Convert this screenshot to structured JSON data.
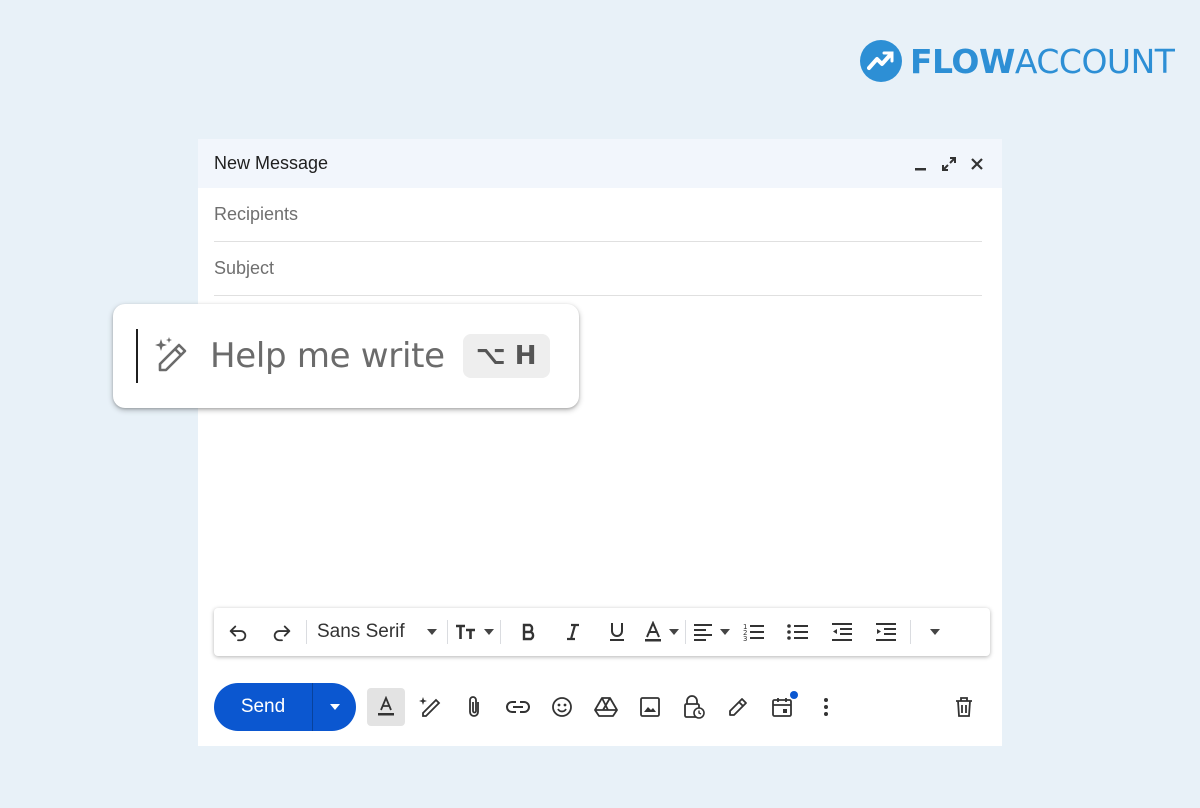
{
  "brand": {
    "logo_bold": "FLOW",
    "logo_light": "ACCOUNT",
    "color": "#2d8fd5"
  },
  "compose": {
    "title": "New Message",
    "recipients_placeholder": "Recipients",
    "subject_placeholder": "Subject",
    "header_icons": [
      "minimize-icon",
      "expand-icon",
      "close-icon"
    ]
  },
  "help_me_write": {
    "label": "Help me write",
    "shortcut": "⌥ H",
    "icon": "magic-pen-icon"
  },
  "format_toolbar": {
    "font": "Sans Serif",
    "icons": [
      "undo-icon",
      "redo-icon",
      "font-size-icon",
      "bold-icon",
      "italic-icon",
      "underline-icon",
      "text-color-icon",
      "align-icon",
      "numbered-list-icon",
      "bulleted-list-icon",
      "indent-less-icon",
      "indent-more-icon",
      "more-formatting-icon"
    ]
  },
  "bottom_bar": {
    "send_label": "Send",
    "accent": "#0b57d0",
    "icons": [
      "formatting-options-icon",
      "help-me-write-icon",
      "attach-icon",
      "link-icon",
      "emoji-icon",
      "drive-icon",
      "photo-icon",
      "confidential-mode-icon",
      "signature-icon",
      "schedule-icon",
      "more-options-icon",
      "discard-icon"
    ]
  }
}
